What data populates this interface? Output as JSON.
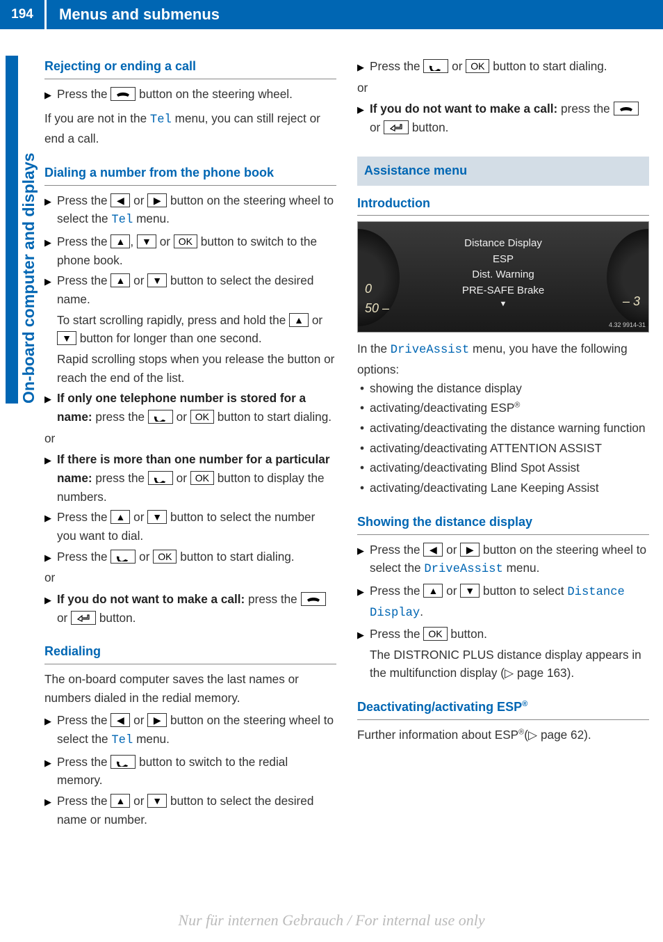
{
  "page_number": "194",
  "chapter_title": "Menus and submenus",
  "side_tab": "On-board computer and displays",
  "watermark": "Nur für internen Gebrauch / For internal use only",
  "icons": {
    "hangup": "hangup-icon",
    "pickup": "pickup-icon",
    "left": "◀",
    "right": "▶",
    "up": "▲",
    "down": "▼",
    "ok": "OK",
    "back": "back-icon"
  },
  "left": {
    "h_reject": "Rejecting or ending a call",
    "reject_1a": "Press the ",
    "reject_1b": " button on the steering wheel.",
    "reject_note_a": "If you are not in the ",
    "reject_note_tel": "Tel",
    "reject_note_b": " menu, you can still reject or end a call.",
    "h_dial": "Dialing a number from the phone book",
    "dial_1a": "Press the ",
    "dial_1b": " or ",
    "dial_1c": " button on the steering wheel to select the ",
    "dial_1_tel": "Tel",
    "dial_1d": " menu.",
    "dial_2a": "Press the ",
    "dial_2b": ", ",
    "dial_2c": " or ",
    "dial_2d": " button to switch to the phone book.",
    "dial_3a": "Press the ",
    "dial_3b": " or ",
    "dial_3c": " button to select the desired name.",
    "dial_3_note1a": "To start scrolling rapidly, press and hold the ",
    "dial_3_note1b": " or ",
    "dial_3_note1c": " button for longer than one second.",
    "dial_3_note2": "Rapid scrolling stops when you release the button or reach the end of the list.",
    "dial_4_bold": "If only one telephone number is stored for a name:",
    "dial_4a": " press the ",
    "dial_4b": " or ",
    "dial_4c": " button to start dialing.",
    "or": "or",
    "dial_5_bold": "If there is more than one number for a particular name:",
    "dial_5a": " press the ",
    "dial_5b": " or ",
    "dial_5c": " button to display the numbers.",
    "dial_6a": "Press the ",
    "dial_6b": " or ",
    "dial_6c": " button to select the number you want to dial.",
    "dial_7a": "Press the ",
    "dial_7b": " or ",
    "dial_7c": " button to start dialing.",
    "dial_8_bold": "If you do not want to make a call:",
    "dial_8a": " press the ",
    "dial_8b": " or ",
    "dial_8c": " button.",
    "h_redial": "Redialing",
    "redial_intro": "The on-board computer saves the last names or numbers dialed in the redial memory.",
    "redial_1a": "Press the ",
    "redial_1b": " or ",
    "redial_1c": " button on the steering wheel to select the ",
    "redial_1_tel": "Tel",
    "redial_1d": " menu.",
    "redial_2a": "Press the ",
    "redial_2b": " button to switch to the redial memory.",
    "redial_3a": "Press the ",
    "redial_3b": " or ",
    "redial_3c": " button to select the desired name or number."
  },
  "right": {
    "top_1a": "Press the ",
    "top_1b": " or ",
    "top_1c": " button to start dialing.",
    "or": "or",
    "top_2_bold": "If you do not want to make a call:",
    "top_2a": " press the ",
    "top_2b": " or ",
    "top_2c": " button.",
    "section": "Assistance menu",
    "h_intro": "Introduction",
    "dash": {
      "line1": "Distance Display",
      "line2": "ESP",
      "line3": "Dist. Warning",
      "line4": "PRE-SAFE Brake",
      "nl_a": "0",
      "nl_b": "50",
      "nr": "3",
      "code": "4.32 9914-31"
    },
    "intro_a": "In the ",
    "intro_menu": "DriveAssist",
    "intro_b": " menu, you have the following options:",
    "b1": "showing the distance display",
    "b2a": "activating/deactivating ESP",
    "b2_sup": "®",
    "b3": "activating/deactivating the distance warning function",
    "b4": "activating/deactivating ATTENTION ASSIST",
    "b5": "activating/deactivating Blind Spot Assist",
    "b6": "activating/deactivating Lane Keeping Assist",
    "h_show": "Showing the distance display",
    "show_1a": "Press the ",
    "show_1b": " or ",
    "show_1c": " button on the steering wheel to select the ",
    "show_1_menu": "DriveAssist",
    "show_1d": " menu.",
    "show_2a": "Press the ",
    "show_2b": " or ",
    "show_2c": " button to select ",
    "show_2_menu": "Distance Display",
    "show_2d": ".",
    "show_3a": "Press the ",
    "show_3b": " button.",
    "show_3_note_a": "The DISTRONIC PLUS distance display appears in the multifunction display (",
    "show_3_note_page": "▷ page 163",
    "show_3_note_b": ").",
    "h_esp_a": "Deactivating/activating ESP",
    "h_esp_sup": "®",
    "esp_a": "Further information about ESP",
    "esp_sup": "®",
    "esp_b": "(",
    "esp_page": "▷ page 62",
    "esp_c": ")."
  }
}
